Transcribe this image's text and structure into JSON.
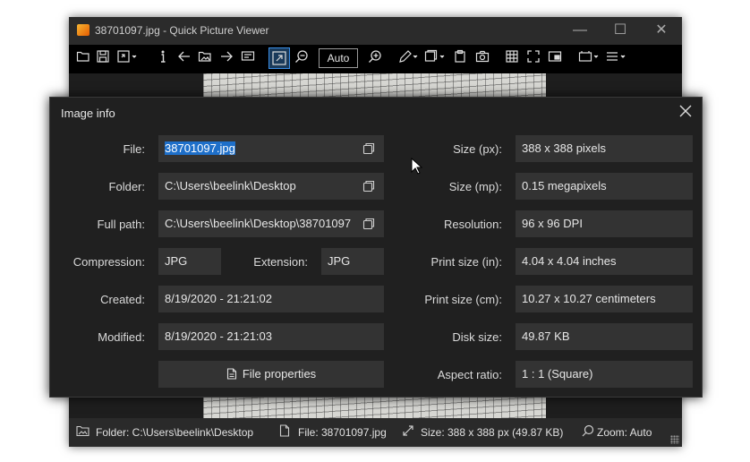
{
  "window": {
    "title": "38701097.jpg - Quick Picture Viewer",
    "controls": {
      "minimize": "—",
      "maximize": "☐",
      "close": "✕"
    }
  },
  "toolbar": {
    "zoom_value": "Auto",
    "icons": [
      "open-folder-icon",
      "save-icon",
      "save-as-icon",
      "info-icon",
      "previous-icon",
      "gallery-icon",
      "next-icon",
      "slideshow-icon",
      "auto-zoom-icon",
      "zoom-out-icon",
      "zoom-in-icon",
      "edit-icon",
      "copy-image-icon",
      "paste-icon",
      "screenshot-icon",
      "grid-icon",
      "fullscreen-icon",
      "picture-in-picture-icon",
      "more-icon",
      "menu-icon"
    ]
  },
  "statusbar": {
    "folder": "Folder: C:\\Users\\beelink\\Desktop",
    "file": "File: 38701097.jpg",
    "size": "Size: 388 x 388 px (49.87 KB)",
    "zoom": "Zoom: Auto"
  },
  "dialog": {
    "title": "Image info",
    "left": {
      "file_label": "File:",
      "file_value": "38701097.jpg",
      "folder_label": "Folder:",
      "folder_value": "C:\\Users\\beelink\\Desktop",
      "fullpath_label": "Full path:",
      "fullpath_value": "C:\\Users\\beelink\\Desktop\\38701097",
      "compression_label": "Compression:",
      "compression_value": "JPG",
      "extension_label": "Extension:",
      "extension_value": "JPG",
      "created_label": "Created:",
      "created_value": "8/19/2020 - 21:21:02",
      "modified_label": "Modified:",
      "modified_value": "8/19/2020 - 21:21:03",
      "properties_button": "File properties"
    },
    "right": {
      "size_px_label": "Size (px):",
      "size_px_value": "388 x 388 pixels",
      "size_mp_label": "Size (mp):",
      "size_mp_value": "0.15 megapixels",
      "resolution_label": "Resolution:",
      "resolution_value": "96 x 96 DPI",
      "print_in_label": "Print size (in):",
      "print_in_value": "4.04 x 4.04 inches",
      "print_cm_label": "Print size (cm):",
      "print_cm_value": "10.27 x 10.27 centimeters",
      "disk_label": "Disk size:",
      "disk_value": "49.87 KB",
      "aspect_label": "Aspect ratio:",
      "aspect_value": "1 : 1 (Square)"
    }
  },
  "colors": {
    "window_bg": "#222222",
    "field_bg": "#333333",
    "selection": "#1e6fc9",
    "accent": "#3a8ee6"
  }
}
